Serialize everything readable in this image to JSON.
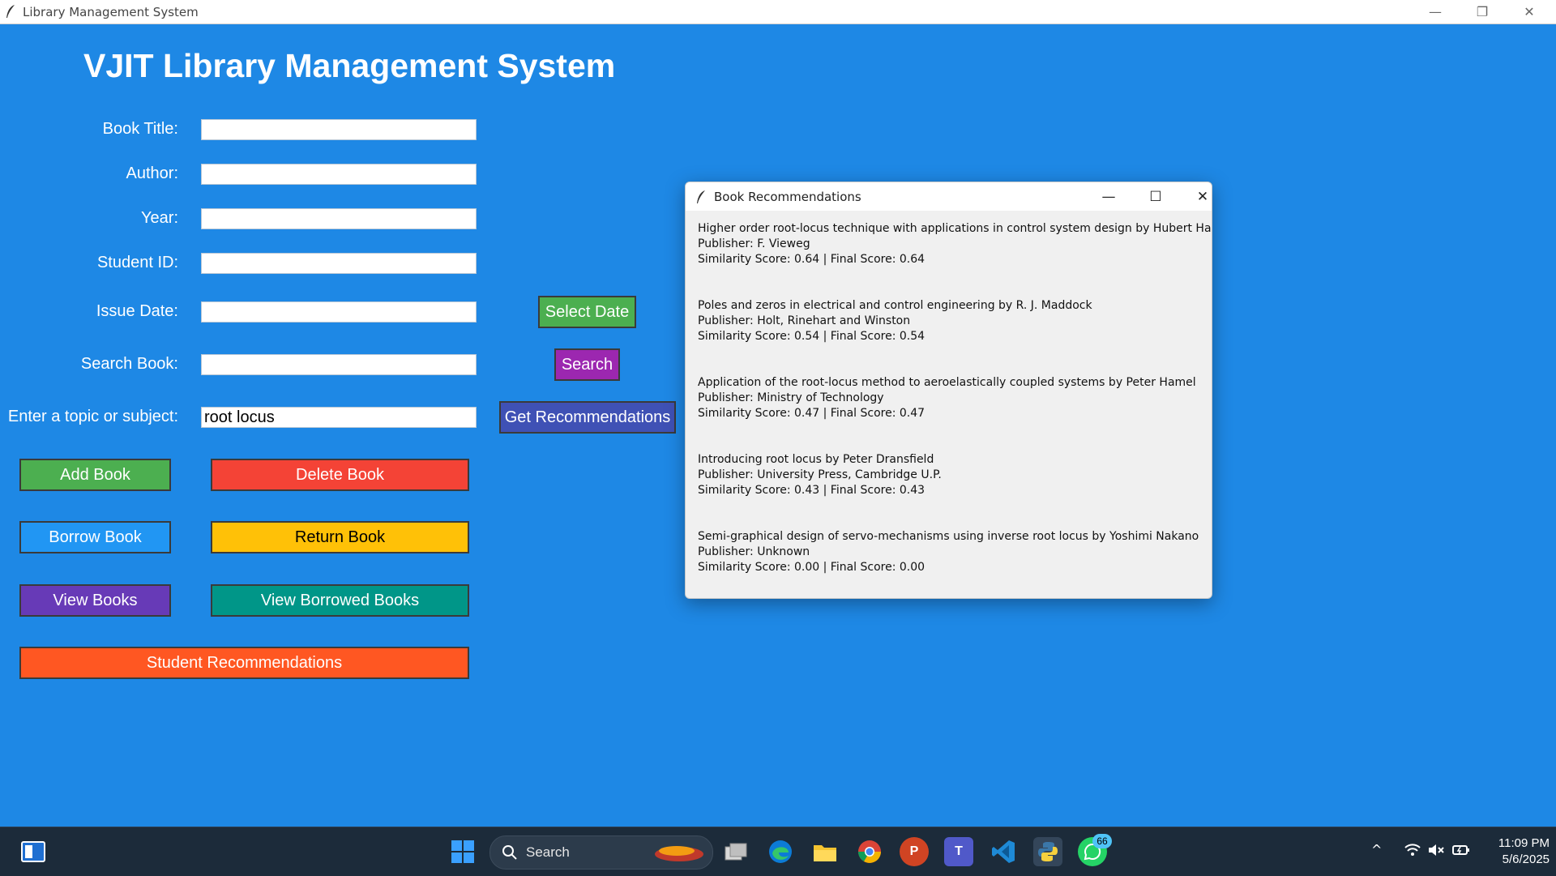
{
  "window": {
    "title": "Library Management System",
    "controls": {
      "minimize": "—",
      "restore": "❐",
      "close": "✕"
    }
  },
  "app": {
    "heading": "VJIT Library Management System",
    "fields": [
      {
        "label": "Book Title:",
        "value": "",
        "placeholder": ""
      },
      {
        "label": "Author:",
        "value": "",
        "placeholder": ""
      },
      {
        "label": "Year:",
        "value": "",
        "placeholder": ""
      },
      {
        "label": "Student ID:",
        "value": "",
        "placeholder": ""
      },
      {
        "label": "Issue Date:",
        "value": "",
        "placeholder": ""
      },
      {
        "label": "Search Book:",
        "value": "",
        "placeholder": ""
      },
      {
        "label": "Enter a topic or subject:",
        "value": "root locus",
        "placeholder": ""
      }
    ],
    "buttons": {
      "select_date": "Select Date",
      "search": "Search",
      "get_recommendations": "Get Recommendations",
      "add_book": "Add Book",
      "delete_book": "Delete Book",
      "borrow_book": "Borrow Book",
      "return_book": "Return Book",
      "view_books": "View Books",
      "view_borrowed_books": "View Borrowed Books",
      "student_recommendations": "Student Recommendations"
    },
    "colors": {
      "background": "#1e88e5",
      "select_date": "#4caf50",
      "search": "#9c27b0",
      "get_recommendations": "#3f51b5",
      "add_book": "#4caf50",
      "delete_book": "#f44336",
      "borrow_book": "#2196f3",
      "return_book": "#ffc107",
      "view_books": "#673ab7",
      "view_borrowed_books": "#009688",
      "student_recommendations": "#ff5722"
    }
  },
  "popup": {
    "title": "Book Recommendations",
    "controls": {
      "minimize": "—",
      "maximize": "☐",
      "close": "✕"
    },
    "recommendations": [
      {
        "title_line": "Higher order root-locus technique with applications in control system design by Hubert Hahn",
        "publisher": "Publisher: F. Vieweg",
        "score": "Similarity Score: 0.64 | Final Score: 0.64"
      },
      {
        "title_line": "Poles and zeros in electrical and control engineering by R. J. Maddock",
        "publisher": "Publisher: Holt, Rinehart and Winston",
        "score": "Similarity Score: 0.54 | Final Score: 0.54"
      },
      {
        "title_line": "Application of the root-locus method to aeroelastically coupled systems by Peter Hamel",
        "publisher": "Publisher: Ministry of Technology",
        "score": "Similarity Score: 0.47 | Final Score: 0.47"
      },
      {
        "title_line": "Introducing root locus by Peter Dransfield",
        "publisher": "Publisher: University Press, Cambridge U.P.",
        "score": "Similarity Score: 0.43 | Final Score: 0.43"
      },
      {
        "title_line": "Semi-graphical design of servo-mechanisms using inverse root locus by Yoshimi Nakano",
        "publisher": "Publisher: Unknown",
        "score": "Similarity Score: 0.00 | Final Score: 0.00"
      }
    ]
  },
  "taskbar": {
    "search_label": "Search",
    "apps": [
      "start-icon",
      "task-view-icon",
      "edge-icon",
      "file-explorer-icon",
      "chrome-icon",
      "powerpoint-icon",
      "teams-icon",
      "vscode-icon",
      "python-icon",
      "whatsapp-icon"
    ],
    "whatsapp_badge": "66",
    "time": "11:09 PM",
    "date": "5/6/2025"
  }
}
